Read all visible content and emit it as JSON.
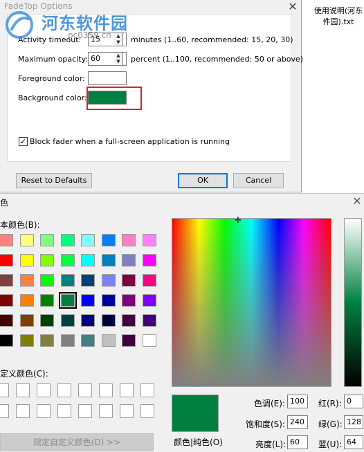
{
  "fadetop": {
    "title": "FadeTop Options",
    "close_glyph": "✕",
    "activity_label": "Activity timeout:",
    "activity_value": "15",
    "activity_hint": "minutes (1..60, recommended: 15, 20, 30)",
    "opacity_label": "Maximum opacity:",
    "opacity_value": "60",
    "opacity_hint": "percent (1..100, recommended: 50 or above)",
    "foreground_label": "Foreground color:",
    "foreground_color": "#ffffff",
    "background_label": "Background color:",
    "background_color": "#008040",
    "highlight_color": "#e02020",
    "block_fader_label": "Block fader when a full-screen application is running",
    "block_fader_checked": true,
    "reset_label": "Reset to Defaults",
    "ok_label": "OK",
    "cancel_label": "Cancel"
  },
  "watermark": {
    "text": "河东软件园",
    "url": "pc0359.cn"
  },
  "desktop_file": {
    "line1": "使用说明(河东",
    "line2": "件园).txt"
  },
  "color_dialog": {
    "title": "色",
    "close_glyph": "✕",
    "basic_colors_label": "本颜色(B):",
    "custom_colors_label": "定义颜色(C):",
    "define_custom_button": "规定自定义颜色(D) >>",
    "selected_cell": 27,
    "basic_colors": [
      "#ff8080",
      "#ffff80",
      "#80ff80",
      "#00ff80",
      "#80ffff",
      "#0080ff",
      "#ff80c0",
      "#ff80ff",
      "#ff0000",
      "#ffff00",
      "#80ff00",
      "#00ff40",
      "#00ffff",
      "#0080c0",
      "#8080c0",
      "#ff00ff",
      "#804040",
      "#ff8040",
      "#00ff00",
      "#008080",
      "#004080",
      "#8080ff",
      "#800040",
      "#ff0080",
      "#800000",
      "#ff8000",
      "#008000",
      "#008040",
      "#0000ff",
      "#0000a0",
      "#800080",
      "#8000ff",
      "#400000",
      "#804000",
      "#004000",
      "#004040",
      "#000080",
      "#000040",
      "#400040",
      "#400080",
      "#000000",
      "#808000",
      "#808040",
      "#808080",
      "#408080",
      "#c0c0c0",
      "#400040",
      "#ffffff"
    ],
    "preview_color": "#008040",
    "preview_label": "颜色|纯色(O)",
    "hue_label": "色调(E):",
    "hue_value": "100",
    "sat_label": "饱和度(S):",
    "sat_value": "240",
    "lum_label": "亮度(L):",
    "lum_value": "60",
    "red_label": "红(R):",
    "red_value": "0",
    "green_label": "绿(G):",
    "green_value": "128",
    "blue_label": "蓝(U):",
    "blue_value": "64"
  }
}
